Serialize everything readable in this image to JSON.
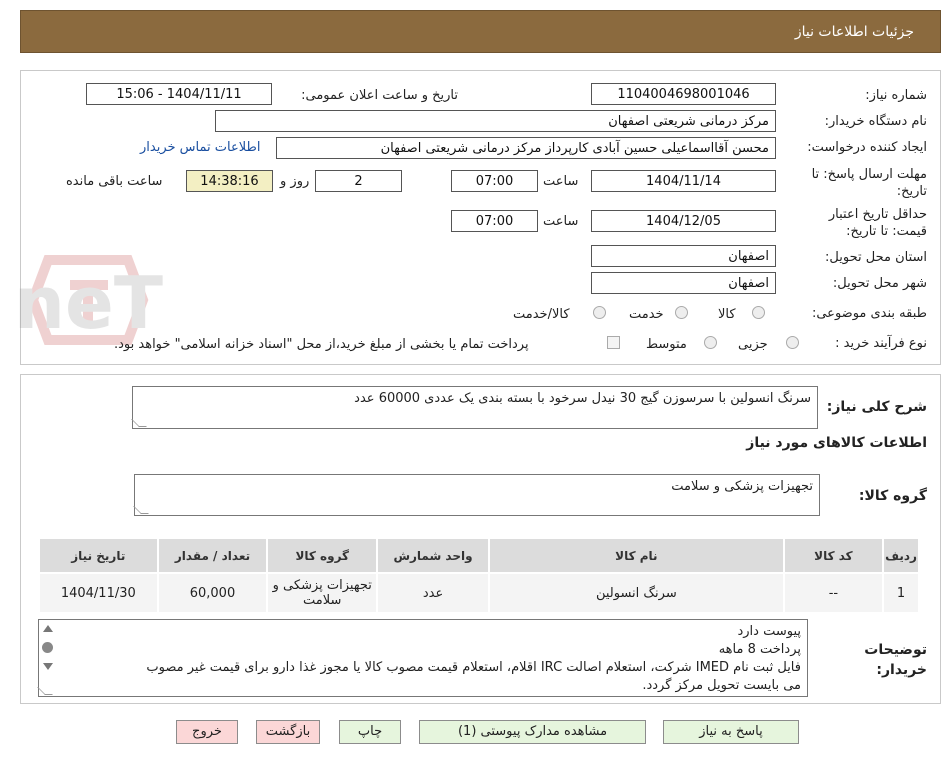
{
  "header": {
    "title": "جزئیات اطلاعات نیاز"
  },
  "watermark": {
    "text": "AriaTender.neT"
  },
  "form": {
    "need_number": {
      "label": "شماره نیاز:",
      "value": "1104004698001046"
    },
    "announce_datetime": {
      "label": "تاریخ و ساعت اعلان عمومی:",
      "value": "1404/11/11 - 15:06"
    },
    "buyer_org": {
      "label": "نام دستگاه خریدار:",
      "value": "مرکز درمانی شریعتی اصفهان"
    },
    "requester": {
      "label": "ایجاد کننده درخواست:",
      "value": "محسن آقااسماعیلی حسین آبادی کارپرداز مرکز درمانی شریعتی اصفهان"
    },
    "contact_link": "اطلاعات تماس خریدار",
    "reply_deadline": {
      "label": "مهلت ارسال پاسخ: تا تاریخ:",
      "date": "1404/11/14",
      "time_label": "ساعت",
      "time": "07:00",
      "days": "2",
      "days_label": "روز و",
      "remaining": "14:38:16",
      "remaining_label": "ساعت باقی مانده"
    },
    "price_validity": {
      "label": "حداقل تاریخ اعتبار قیمت: تا تاریخ:",
      "date": "1404/12/05",
      "time_label": "ساعت",
      "time": "07:00"
    },
    "province": {
      "label": "استان محل تحویل:",
      "value": "اصفهان"
    },
    "city": {
      "label": "شهر محل تحویل:",
      "value": "اصفهان"
    },
    "category": {
      "label": "طبقه بندی موضوعی:",
      "options": [
        "کالا",
        "خدمت",
        "کالا/خدمت"
      ]
    },
    "purchase_type": {
      "label": "نوع فرآیند خرید :",
      "options": [
        "جزیی",
        "متوسط"
      ],
      "payment_note": "پرداخت تمام یا بخشی از مبلغ خرید،از محل \"اسناد خزانه اسلامی\" خواهد بود."
    }
  },
  "summary": {
    "label": "شرح کلی نیاز:",
    "value": "سرنگ انسولین با  سرسوزن گیج 30 نیدل سرخود با بسته بندی یک عددی 60000 عدد"
  },
  "goods": {
    "section_title": "اطلاعات کالاهای مورد نیاز",
    "group_label": "گروه کالا:",
    "group_value": "تجهیزات پزشکی و سلامت",
    "table": {
      "headers": [
        "ردیف",
        "کد کالا",
        "نام کالا",
        "واحد شمارش",
        "گروه کالا",
        "تعداد / مقدار",
        "تاریخ نیاز"
      ],
      "rows": [
        [
          "1",
          "--",
          "سرنگ انسولین",
          "عدد",
          "تجهیزات پزشکی و سلامت",
          "60,000",
          "1404/11/30"
        ]
      ]
    }
  },
  "buyer_notes": {
    "label": "توضیحات خریدار:",
    "lines": [
      "پیوست دارد",
      "پرداخت 8 ماهه",
      "فایل ثبت نام IMED شرکت، استعلام اصالت IRC اقلام، استعلام قیمت مصوب کالا یا مجوز غذا دارو برای قیمت غیر مصوب",
      "می بایست تحویل مرکز گردد."
    ]
  },
  "buttons": {
    "reply": "پاسخ به نیاز",
    "attachments": "مشاهده مدارک پیوستی (1)",
    "print": "چاپ",
    "back": "بازگشت",
    "exit": "خروج"
  },
  "colors": {
    "header": "#8b6a3e",
    "remaining_bg": "#f3efc3",
    "link": "#1a4fa0"
  }
}
